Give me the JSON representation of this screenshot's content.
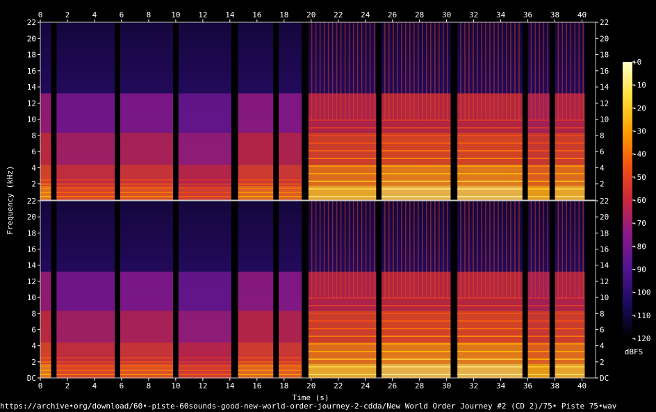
{
  "chart_data": {
    "type": "heatmap",
    "title": "",
    "xlabel": "Time (s)",
    "ylabel": "Frequency (kHz)",
    "xlim": [
      0,
      41
    ],
    "ylim_khz": [
      0,
      22
    ],
    "x_ticks": [
      "0",
      "2",
      "4",
      "6",
      "8",
      "10",
      "12",
      "14",
      "16",
      "18",
      "20",
      "22",
      "24",
      "26",
      "28",
      "30",
      "32",
      "34",
      "36",
      "38",
      "40"
    ],
    "y_ticks_top": [
      "22",
      "20",
      "18",
      "16",
      "14",
      "12",
      "10",
      "8",
      "6",
      "4",
      "2"
    ],
    "y_ticks_bottom": [
      "22",
      "20",
      "18",
      "16",
      "14",
      "12",
      "10",
      "8",
      "6",
      "4",
      "2",
      "DC"
    ],
    "channels": 2,
    "colorbar": {
      "label": "dBFS",
      "range_db": [
        -120,
        0
      ],
      "ticks": [
        "+0",
        "-10",
        "-20",
        "-30",
        "-40",
        "-50",
        "-60",
        "-70",
        "-80",
        "-90",
        "-100",
        "-110",
        "-120"
      ],
      "colors": [
        "#000000",
        "#1a0a5a",
        "#50148f",
        "#8c1a8c",
        "#c8283c",
        "#f05014",
        "#ffb400",
        "#ffffc8"
      ]
    },
    "segments": [
      {
        "start": 0.0,
        "end": 0.8,
        "level_db": -55,
        "type": "speech"
      },
      {
        "start": 1.2,
        "end": 5.5,
        "level_db": -65,
        "type": "speech"
      },
      {
        "start": 5.9,
        "end": 9.8,
        "level_db": -62,
        "type": "speech"
      },
      {
        "start": 10.2,
        "end": 14.1,
        "level_db": -70,
        "type": "speech"
      },
      {
        "start": 14.6,
        "end": 17.2,
        "level_db": -58,
        "type": "speech"
      },
      {
        "start": 17.6,
        "end": 19.3,
        "level_db": -60,
        "type": "speech"
      },
      {
        "start": 19.8,
        "end": 24.8,
        "level_db": -45,
        "type": "tonal"
      },
      {
        "start": 25.2,
        "end": 30.3,
        "level_db": -42,
        "type": "tonal"
      },
      {
        "start": 30.8,
        "end": 35.6,
        "level_db": -42,
        "type": "tonal"
      },
      {
        "start": 36.0,
        "end": 37.6,
        "level_db": -48,
        "type": "tonal"
      },
      {
        "start": 38.0,
        "end": 40.2,
        "level_db": -45,
        "type": "tonal"
      }
    ]
  },
  "footer": {
    "source_path": "https://archive•org/download/60•-piste-60sounds-good-new-world-order-journey-2-cdda/New World Order Journey #2 (CD 2)/75• Piste 75•wav"
  }
}
